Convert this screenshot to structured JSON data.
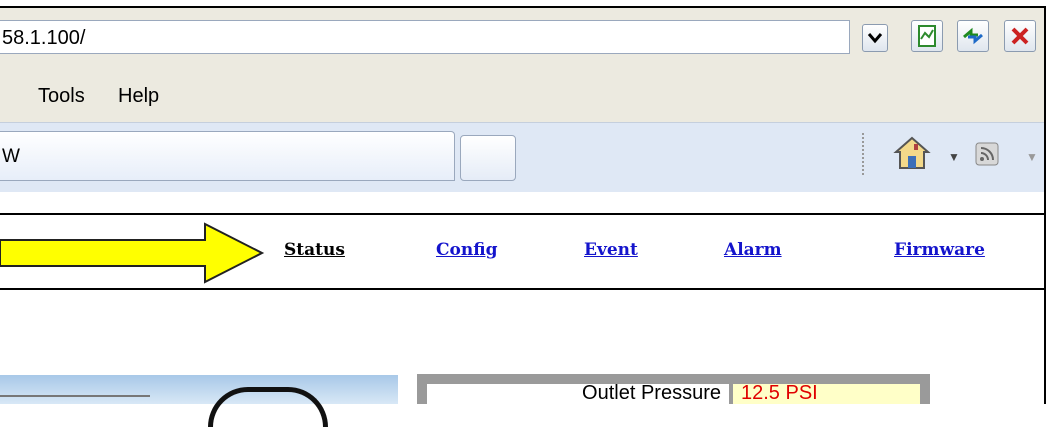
{
  "browser": {
    "address_bar": {
      "url": "58.1.100/"
    },
    "menu": {
      "items": [
        {
          "label": "Tools"
        },
        {
          "label": "Help"
        }
      ]
    },
    "tab": {
      "title": "W"
    }
  },
  "page": {
    "nav": {
      "items": [
        {
          "label": "Status"
        },
        {
          "label": "Config"
        },
        {
          "label": "Event"
        },
        {
          "label": "Alarm"
        },
        {
          "label": "Firmware"
        }
      ]
    },
    "readings": {
      "outlet_pressure": {
        "label": "Outlet Pressure",
        "value": "12.5 PSI"
      }
    }
  },
  "colors": {
    "arrow_fill": "#ffff00",
    "link_color": "#1414cc",
    "value_color": "#e00000"
  }
}
